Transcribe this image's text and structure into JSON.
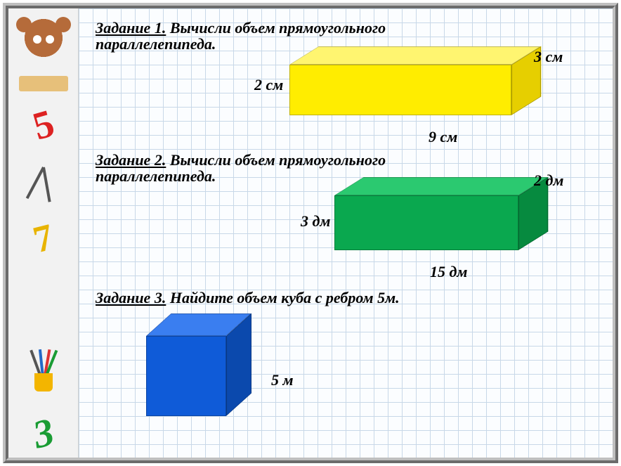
{
  "tasks": {
    "t1": {
      "label": "Задание 1.",
      "text": "Вычисли объем  прямоугольного параллелепипеда.",
      "dims": {
        "h": "2 см",
        "w": "9 см",
        "d": "3 см"
      }
    },
    "t2": {
      "label": "Задание 2.",
      "text": "Вычисли объем  прямоугольного параллелепипеда.",
      "dims": {
        "h": "3 дм",
        "w": "15 дм",
        "d": "2 дм"
      }
    },
    "t3": {
      "label": "Задание 3.",
      "text": "Найдите объем куба с ребром 5м.",
      "dims": {
        "edge": "5 м"
      }
    }
  },
  "sidebar": {
    "digits": [
      "5",
      "7",
      "3"
    ]
  },
  "chart_data": [
    {
      "type": "table",
      "title": "Rectangular box 1",
      "series": [
        {
          "name": "length",
          "values": [
            9
          ],
          "unit": "см"
        },
        {
          "name": "width",
          "values": [
            3
          ],
          "unit": "см"
        },
        {
          "name": "height",
          "values": [
            2
          ],
          "unit": "см"
        }
      ]
    },
    {
      "type": "table",
      "title": "Rectangular box 2",
      "series": [
        {
          "name": "length",
          "values": [
            15
          ],
          "unit": "дм"
        },
        {
          "name": "width",
          "values": [
            2
          ],
          "unit": "дм"
        },
        {
          "name": "height",
          "values": [
            3
          ],
          "unit": "дм"
        }
      ]
    },
    {
      "type": "table",
      "title": "Cube",
      "series": [
        {
          "name": "edge",
          "values": [
            5
          ],
          "unit": "м"
        }
      ]
    }
  ]
}
